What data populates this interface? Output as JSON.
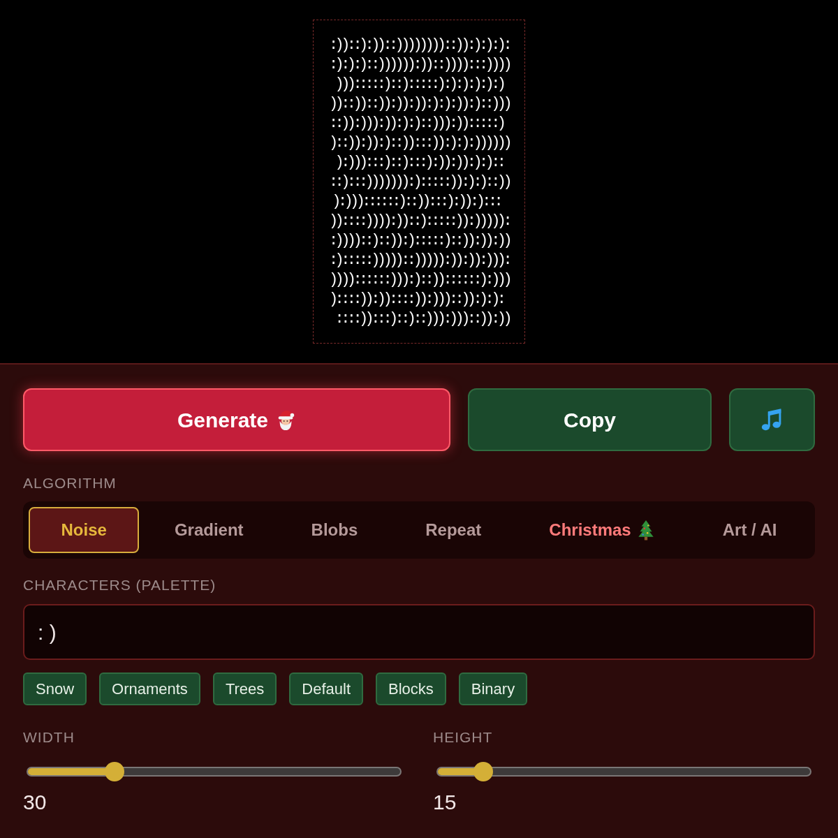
{
  "art": {
    "lines": [
      ":))::):))::))))))))::)):):):):",
      ":):):)::)))))):))::)))):::))))",
      " ))):::::)::):::::):):):):):) ",
      "))::))::)):)):)):):):)):)::)))",
      "::)):))):)):):)::))):)):::::) ",
      ")::)):)):)::)):::)):):):))))))",
      " ):))):::)::):::):)):)):):):: ",
      "::):::))))))):):::::)):):)::))",
      " ):)))::::::)::)):::):)):):::  ",
      "))::::)))):))::):::::)):))))):",
      ":))))::)::)):):::::)::)):)):))",
      ":):::::)))))::))))):)):)):))):",
      "))))::::::))):)::))::::::):)))",
      ")::::)):))::::)):)))::)):):): ",
      " ::::)):::)::)::))):)))::)):))"
    ]
  },
  "buttons": [
    {
      "kind": "generate",
      "label": "Generate"
    },
    {
      "kind": "copy",
      "label": "Copy"
    },
    {
      "kind": "music"
    }
  ],
  "algorithm": {
    "label": "ALGORITHM",
    "tabs": [
      {
        "label": "Noise",
        "selected": true,
        "kind": "plain"
      },
      {
        "label": "Gradient",
        "selected": false,
        "kind": "plain"
      },
      {
        "label": "Blobs",
        "selected": false,
        "kind": "plain"
      },
      {
        "label": "Repeat",
        "selected": false,
        "kind": "plain"
      },
      {
        "label": "Christmas",
        "selected": false,
        "kind": "festive"
      },
      {
        "label": "Art / AI",
        "selected": false,
        "kind": "plain"
      }
    ]
  },
  "palette": {
    "label": "CHARACTERS (PALETTE)",
    "value": ": )",
    "presets": [
      "Snow",
      "Ornaments",
      "Trees",
      "Default",
      "Blocks",
      "Binary"
    ]
  },
  "sliders": [
    {
      "label": "WIDTH",
      "level": 0.235,
      "reading": "30"
    },
    {
      "label": "HEIGHT",
      "level": 0.125,
      "reading": "15"
    }
  ]
}
